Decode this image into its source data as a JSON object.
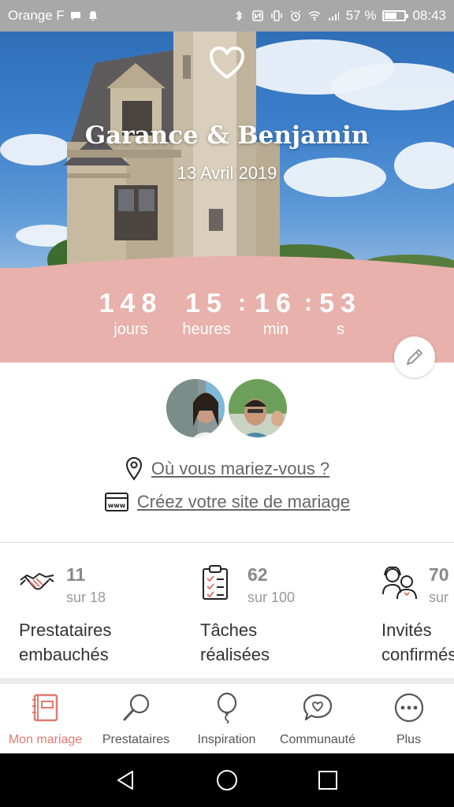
{
  "status_bar": {
    "carrier": "Orange F",
    "battery": "57 %",
    "battery_level": 0.57,
    "time": "08:43"
  },
  "hero": {
    "heart_icon": "heart-outline-icon",
    "couple_names": "Garance & Benjamin",
    "date": "13 Avril 2019"
  },
  "countdown": {
    "days": "148",
    "days_label": "jours",
    "hours": "15",
    "hours_label": "heures",
    "minutes": "16",
    "minutes_label": "min",
    "seconds": "53",
    "seconds_label": "s",
    "separator": ":",
    "edit_icon": "pencil-icon"
  },
  "profile": {
    "location_link": "Où vous mariez-vous ?",
    "website_link": "Créez votre site de mariage"
  },
  "stats": [
    {
      "count": "11",
      "total": "sur 18",
      "label_line1": "Prestataires",
      "label_line2": "embauchés",
      "icon": "handshake-icon"
    },
    {
      "count": "62",
      "total": "sur 100",
      "label_line1": "Tâches",
      "label_line2": "réalisées",
      "icon": "clipboard-icon"
    },
    {
      "count": "70",
      "total": "sur",
      "label_line1": "Invités",
      "label_line2": "confirmés",
      "icon": "guests-icon"
    }
  ],
  "bottom_nav": [
    {
      "label": "Mon mariage",
      "icon": "notebook-icon",
      "active": true
    },
    {
      "label": "Prestataires",
      "icon": "magnifier-icon",
      "active": false
    },
    {
      "label": "Inspiration",
      "icon": "balloon-icon",
      "active": false
    },
    {
      "label": "Communauté",
      "icon": "chat-heart-icon",
      "active": false
    },
    {
      "label": "Plus",
      "icon": "more-icon",
      "active": false
    }
  ],
  "colors": {
    "accent": "#e07a70",
    "countdown_bg": "#e8b1ab",
    "status_bar_bg": "#a8a8a8"
  }
}
